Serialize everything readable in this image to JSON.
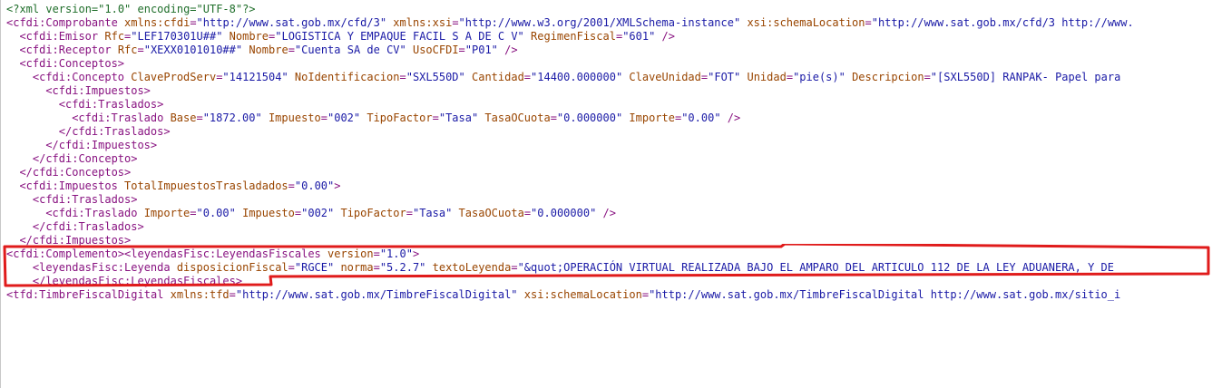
{
  "lines": [
    {
      "ind": 0,
      "parts": [
        [
          "pi",
          "<?xml version=\"1.0\" encoding=\"UTF-8\"?>"
        ]
      ]
    },
    {
      "ind": 0,
      "parts": [
        [
          "t",
          "<cfdi:Comprobante"
        ],
        [
          "a",
          " xmlns:cfdi"
        ],
        [
          "t",
          "="
        ],
        [
          "v",
          "\"http://www.sat.gob.mx/cfd/3\""
        ],
        [
          "a",
          " xmlns:xsi"
        ],
        [
          "t",
          "="
        ],
        [
          "v",
          "\"http://www.w3.org/2001/XMLSchema-instance\""
        ],
        [
          "a",
          " xsi:schemaLocation"
        ],
        [
          "t",
          "="
        ],
        [
          "v",
          "\"http://www.sat.gob.mx/cfd/3 http://www."
        ]
      ]
    },
    {
      "ind": 2,
      "parts": [
        [
          "t",
          "<cfdi:Emisor"
        ],
        [
          "a",
          " Rfc"
        ],
        [
          "t",
          "="
        ],
        [
          "v",
          "\"LEF170301U##\""
        ],
        [
          "a",
          " Nombre"
        ],
        [
          "t",
          "="
        ],
        [
          "v",
          "\"LOGISTICA Y EMPAQUE FACIL S A DE C V\""
        ],
        [
          "a",
          " RegimenFiscal"
        ],
        [
          "t",
          "="
        ],
        [
          "v",
          "\"601\""
        ],
        [
          "t",
          " />"
        ]
      ]
    },
    {
      "ind": 2,
      "parts": [
        [
          "t",
          "<cfdi:Receptor"
        ],
        [
          "a",
          " Rfc"
        ],
        [
          "t",
          "="
        ],
        [
          "v",
          "\"XEXX0101010##\""
        ],
        [
          "a",
          " Nombre"
        ],
        [
          "t",
          "="
        ],
        [
          "v",
          "\"Cuenta SA de CV\""
        ],
        [
          "a",
          " UsoCFDI"
        ],
        [
          "t",
          "="
        ],
        [
          "v",
          "\"P01\""
        ],
        [
          "t",
          " />"
        ]
      ]
    },
    {
      "ind": 2,
      "parts": [
        [
          "t",
          "<cfdi:Conceptos>"
        ]
      ]
    },
    {
      "ind": 4,
      "parts": [
        [
          "t",
          "<cfdi:Concepto"
        ],
        [
          "a",
          " ClaveProdServ"
        ],
        [
          "t",
          "="
        ],
        [
          "v",
          "\"14121504\""
        ],
        [
          "a",
          " NoIdentificacion"
        ],
        [
          "t",
          "="
        ],
        [
          "v",
          "\"SXL550D\""
        ],
        [
          "a",
          " Cantidad"
        ],
        [
          "t",
          "="
        ],
        [
          "v",
          "\"14400.000000\""
        ],
        [
          "a",
          " ClaveUnidad"
        ],
        [
          "t",
          "="
        ],
        [
          "v",
          "\"FOT\""
        ],
        [
          "a",
          " Unidad"
        ],
        [
          "t",
          "="
        ],
        [
          "v",
          "\"pie(s)\""
        ],
        [
          "a",
          " Descripcion"
        ],
        [
          "t",
          "="
        ],
        [
          "v",
          "\"[SXL550D] RANPAK- Papel para"
        ]
      ]
    },
    {
      "ind": 6,
      "parts": [
        [
          "t",
          "<cfdi:Impuestos>"
        ]
      ]
    },
    {
      "ind": 8,
      "parts": [
        [
          "t",
          "<cfdi:Traslados>"
        ]
      ]
    },
    {
      "ind": 10,
      "parts": [
        [
          "t",
          "<cfdi:Traslado"
        ],
        [
          "a",
          " Base"
        ],
        [
          "t",
          "="
        ],
        [
          "v",
          "\"1872.00\""
        ],
        [
          "a",
          " Impuesto"
        ],
        [
          "t",
          "="
        ],
        [
          "v",
          "\"002\""
        ],
        [
          "a",
          " TipoFactor"
        ],
        [
          "t",
          "="
        ],
        [
          "v",
          "\"Tasa\""
        ],
        [
          "a",
          " TasaOCuota"
        ],
        [
          "t",
          "="
        ],
        [
          "v",
          "\"0.000000\""
        ],
        [
          "a",
          " Importe"
        ],
        [
          "t",
          "="
        ],
        [
          "v",
          "\"0.00\""
        ],
        [
          "t",
          " />"
        ]
      ]
    },
    {
      "ind": 8,
      "parts": [
        [
          "t",
          "</cfdi:Traslados>"
        ]
      ]
    },
    {
      "ind": 6,
      "parts": [
        [
          "t",
          "</cfdi:Impuestos>"
        ]
      ]
    },
    {
      "ind": 4,
      "parts": [
        [
          "t",
          "</cfdi:Concepto>"
        ]
      ]
    },
    {
      "ind": 2,
      "parts": [
        [
          "t",
          "</cfdi:Conceptos>"
        ]
      ]
    },
    {
      "ind": 2,
      "parts": [
        [
          "t",
          "<cfdi:Impuestos"
        ],
        [
          "a",
          " TotalImpuestosTrasladados"
        ],
        [
          "t",
          "="
        ],
        [
          "v",
          "\"0.00\""
        ],
        [
          "t",
          ">"
        ]
      ]
    },
    {
      "ind": 4,
      "parts": [
        [
          "t",
          "<cfdi:Traslados>"
        ]
      ]
    },
    {
      "ind": 6,
      "parts": [
        [
          "t",
          "<cfdi:Traslado"
        ],
        [
          "a",
          " Importe"
        ],
        [
          "t",
          "="
        ],
        [
          "v",
          "\"0.00\""
        ],
        [
          "a",
          " Impuesto"
        ],
        [
          "t",
          "="
        ],
        [
          "v",
          "\"002\""
        ],
        [
          "a",
          " TipoFactor"
        ],
        [
          "t",
          "="
        ],
        [
          "v",
          "\"Tasa\""
        ],
        [
          "a",
          " TasaOCuota"
        ],
        [
          "t",
          "="
        ],
        [
          "v",
          "\"0.000000\""
        ],
        [
          "t",
          " />"
        ]
      ]
    },
    {
      "ind": 4,
      "parts": [
        [
          "t",
          "</cfdi:Traslados>"
        ]
      ]
    },
    {
      "ind": 2,
      "parts": [
        [
          "t",
          "</cfdi:Impuestos>"
        ]
      ]
    },
    {
      "ind": 0,
      "parts": [
        [
          "t",
          "<cfdi:Complemento><leyendasFisc:LeyendasFiscales"
        ],
        [
          "a",
          " version"
        ],
        [
          "t",
          "="
        ],
        [
          "v",
          "\"1.0\""
        ],
        [
          "t",
          ">"
        ]
      ]
    },
    {
      "ind": 4,
      "parts": [
        [
          "t",
          "<leyendasFisc:Leyenda"
        ],
        [
          "a",
          " disposicionFiscal"
        ],
        [
          "t",
          "="
        ],
        [
          "v",
          "\"RGCE\""
        ],
        [
          "a",
          " norma"
        ],
        [
          "t",
          "="
        ],
        [
          "v",
          "\"5.2.7\""
        ],
        [
          "a",
          " textoLeyenda"
        ],
        [
          "t",
          "="
        ],
        [
          "v",
          "\"&quot;OPERACIÓN VIRTUAL REALIZADA BAJO EL AMPARO DEL ARTICULO 112 DE LA LEY ADUANERA, Y DE"
        ]
      ]
    },
    {
      "ind": 4,
      "parts": [
        [
          "t",
          "</leyendasFisc:LeyendasFiscales>"
        ]
      ]
    },
    {
      "ind": 0,
      "parts": [
        [
          "t",
          "<tfd:TimbreFiscalDigital"
        ],
        [
          "a",
          " xmlns:tfd"
        ],
        [
          "t",
          "="
        ],
        [
          "v",
          "\"http://www.sat.gob.mx/TimbreFiscalDigital\""
        ],
        [
          "a",
          " xsi:schemaLocation"
        ],
        [
          "t",
          "="
        ],
        [
          "v",
          "\"http://www.sat.gob.mx/TimbreFiscalDigital http://www.sat.gob.mx/sitio_i"
        ]
      ]
    }
  ],
  "highlight": {
    "color": "#e01b1b"
  }
}
